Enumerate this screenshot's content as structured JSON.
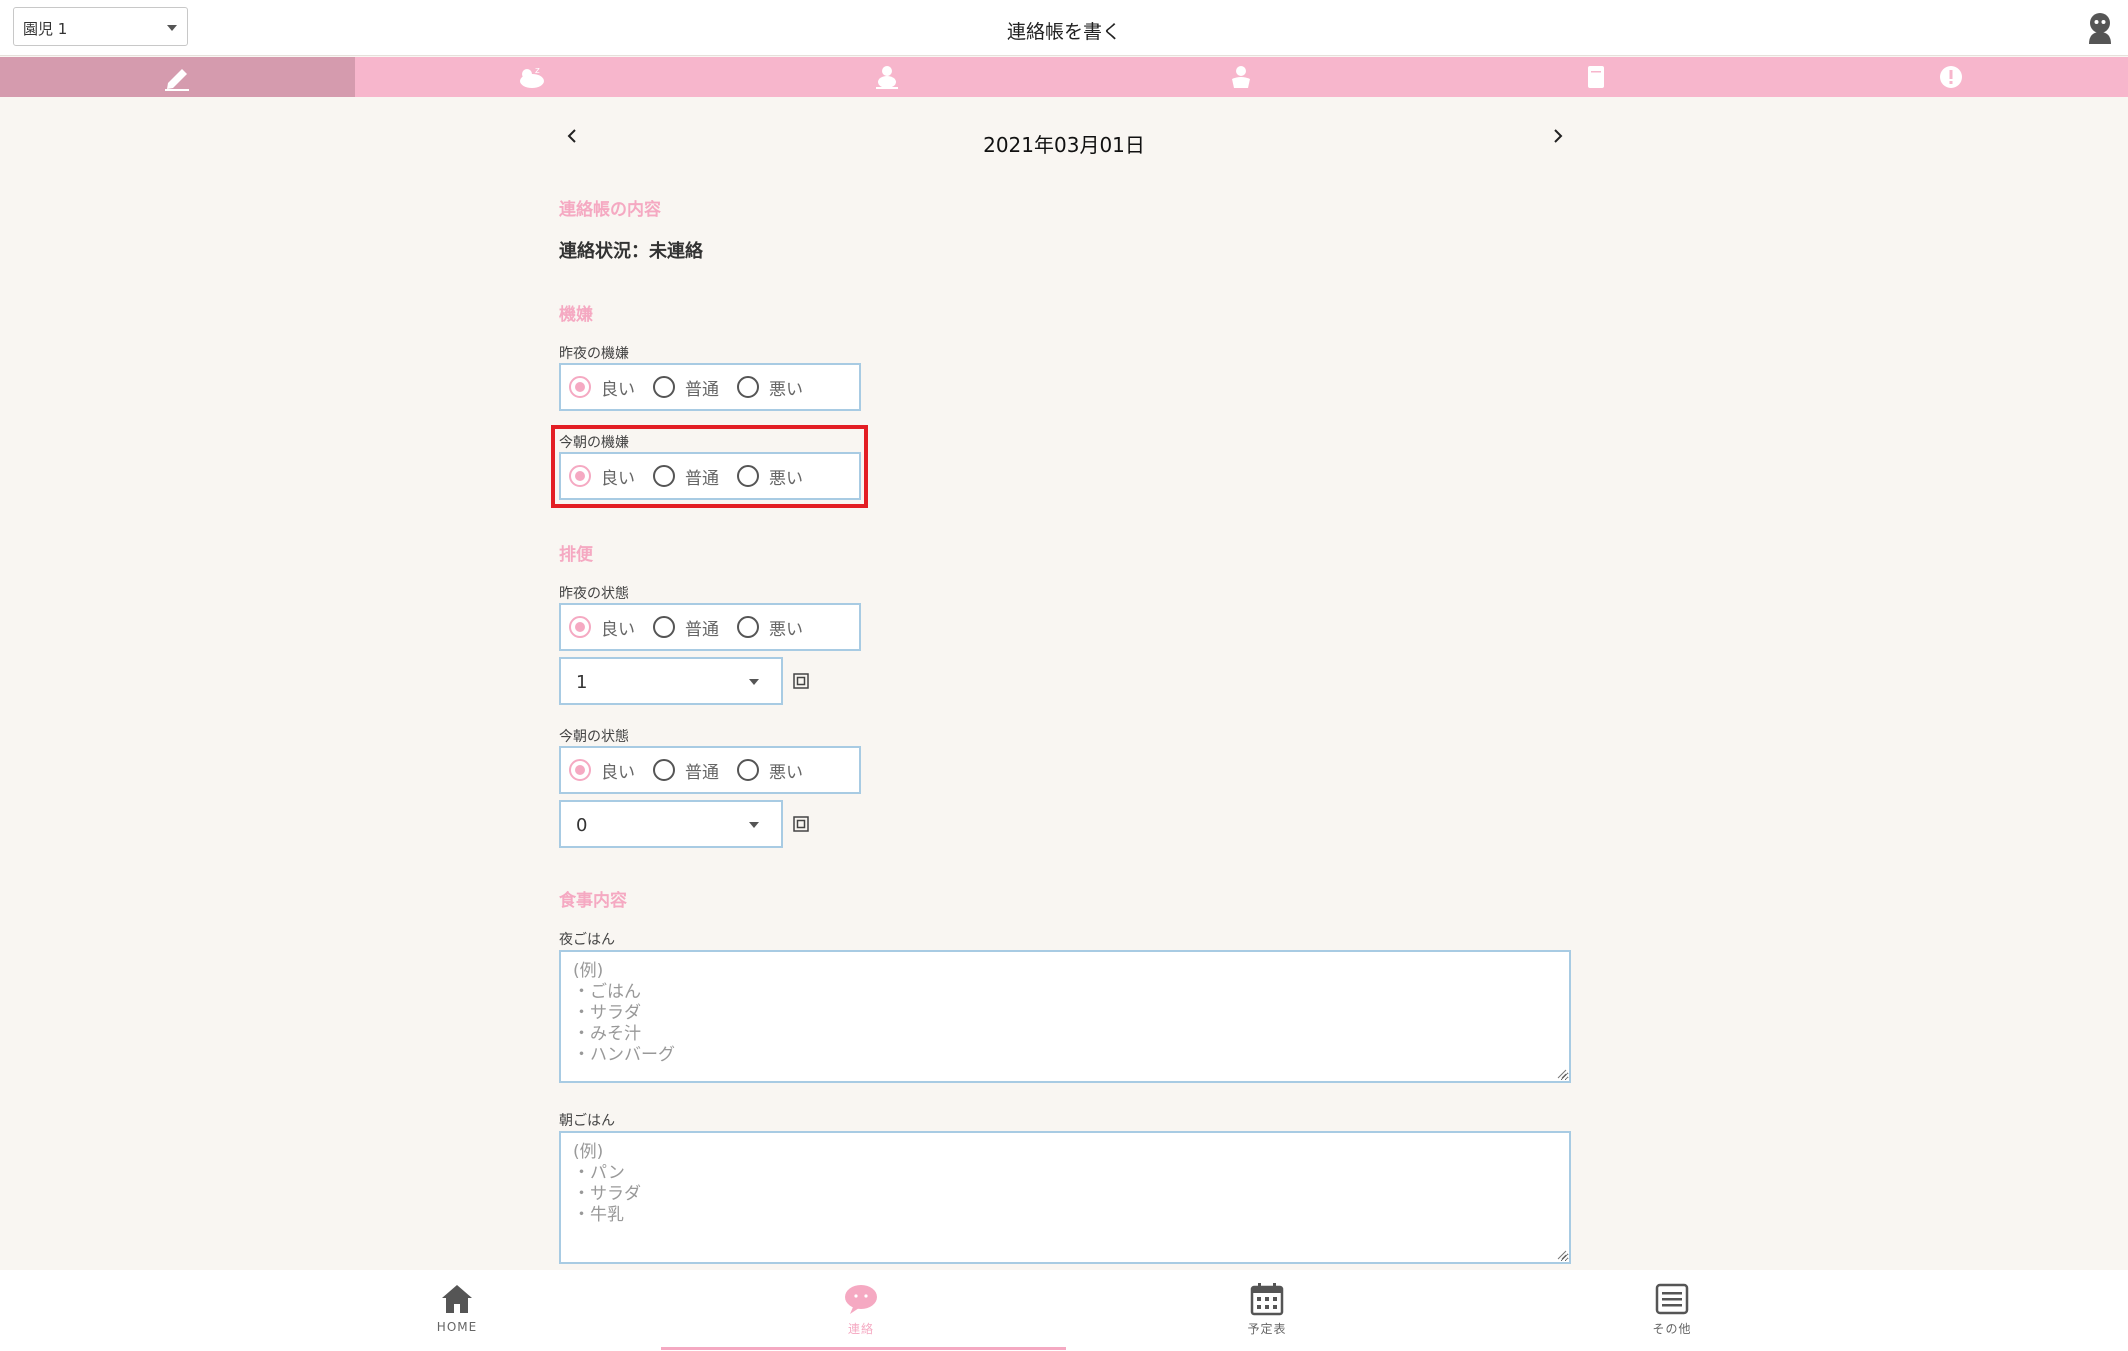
{
  "header": {
    "child_select": "園児 1",
    "title": "連絡帳を書く"
  },
  "tabs": [
    {
      "icon": "pencil-icon",
      "active": true
    },
    {
      "icon": "sleeping-icon",
      "active": false
    },
    {
      "icon": "meal-icon",
      "active": false
    },
    {
      "icon": "toilet-icon",
      "active": false
    },
    {
      "icon": "note-icon",
      "active": false
    },
    {
      "icon": "alert-icon",
      "active": false
    }
  ],
  "date": "2021年03月01日",
  "sections": {
    "contact": {
      "heading": "連絡帳の内容",
      "status": "連絡状況：未連絡"
    },
    "mood": {
      "heading": "機嫌",
      "last_night_label": "昨夜の機嫌",
      "this_morning_label": "今朝の機嫌"
    },
    "bowel": {
      "heading": "排便",
      "last_night_label": "昨夜の状態",
      "last_night_count": "1",
      "this_morning_label": "今朝の状態",
      "this_morning_count": "0"
    },
    "meal": {
      "heading": "食事内容",
      "dinner_label": "夜ごはん",
      "dinner_placeholder": [
        "(例)",
        "・ごはん",
        "・サラダ",
        "・みそ汁",
        "・ハンバーグ"
      ],
      "breakfast_label": "朝ごはん",
      "breakfast_placeholder": [
        "(例)",
        "・パン",
        "・サラダ",
        "・牛乳"
      ]
    }
  },
  "radio_options": {
    "good": "良い",
    "normal": "普通",
    "bad": "悪い"
  },
  "bottom_nav": {
    "home": "HOME",
    "contact": "連絡",
    "schedule": "予定表",
    "other": "その他"
  },
  "colors": {
    "accent_pink": "#f5a9c2",
    "tab_bar": "#f7b6cc",
    "tab_active": "#d59bae",
    "field_border": "#a8cbe3",
    "highlight_red": "#e31e24",
    "background": "#f9f6f2"
  }
}
